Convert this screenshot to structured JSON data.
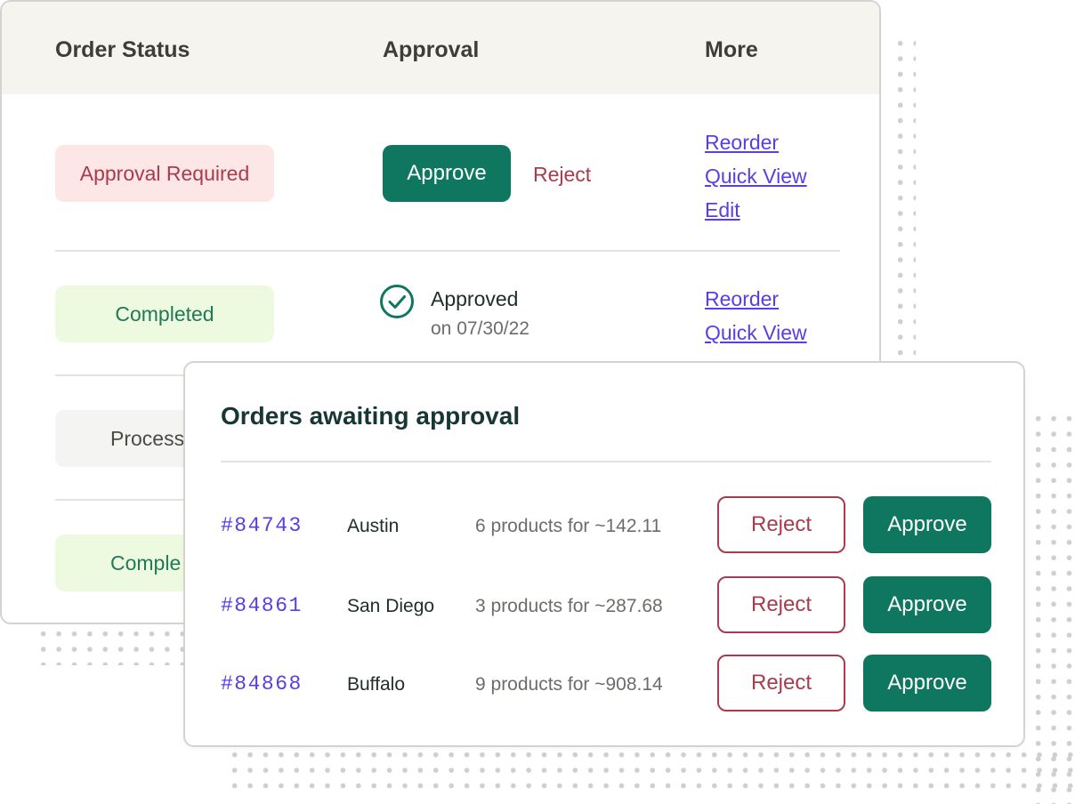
{
  "table": {
    "headers": {
      "status": "Order Status",
      "approval": "Approval",
      "more": "More"
    },
    "rows": [
      {
        "status": "Approval Required",
        "approve_label": "Approve",
        "reject_label": "Reject",
        "links": [
          "Reorder",
          "Quick View",
          "Edit"
        ]
      },
      {
        "status": "Completed",
        "approval_text": "Approved",
        "approval_date": "on 07/30/22",
        "links": [
          "Reorder",
          "Quick View"
        ]
      },
      {
        "status": "Process"
      },
      {
        "status": "Comple"
      }
    ]
  },
  "panel": {
    "title": "Orders awaiting approval",
    "orders": [
      {
        "id": "#84743",
        "city": "Austin",
        "summary": "6 products for ~142.11",
        "reject_label": "Reject",
        "approve_label": "Approve"
      },
      {
        "id": "#84861",
        "city": "San Diego",
        "summary": "3 products for ~287.68",
        "reject_label": "Reject",
        "approve_label": "Approve"
      },
      {
        "id": "#84868",
        "city": "Buffalo",
        "summary": "9 products for ~908.14",
        "reject_label": "Reject",
        "approve_label": "Approve"
      }
    ]
  },
  "icons": {
    "approved": "check-circle-icon"
  },
  "colors": {
    "accent_green": "#0f7760",
    "reject_red": "#a83c4d",
    "link_purple": "#5b3de6",
    "required_bg": "#fde6e6",
    "completed_bg": "#edfadf"
  }
}
